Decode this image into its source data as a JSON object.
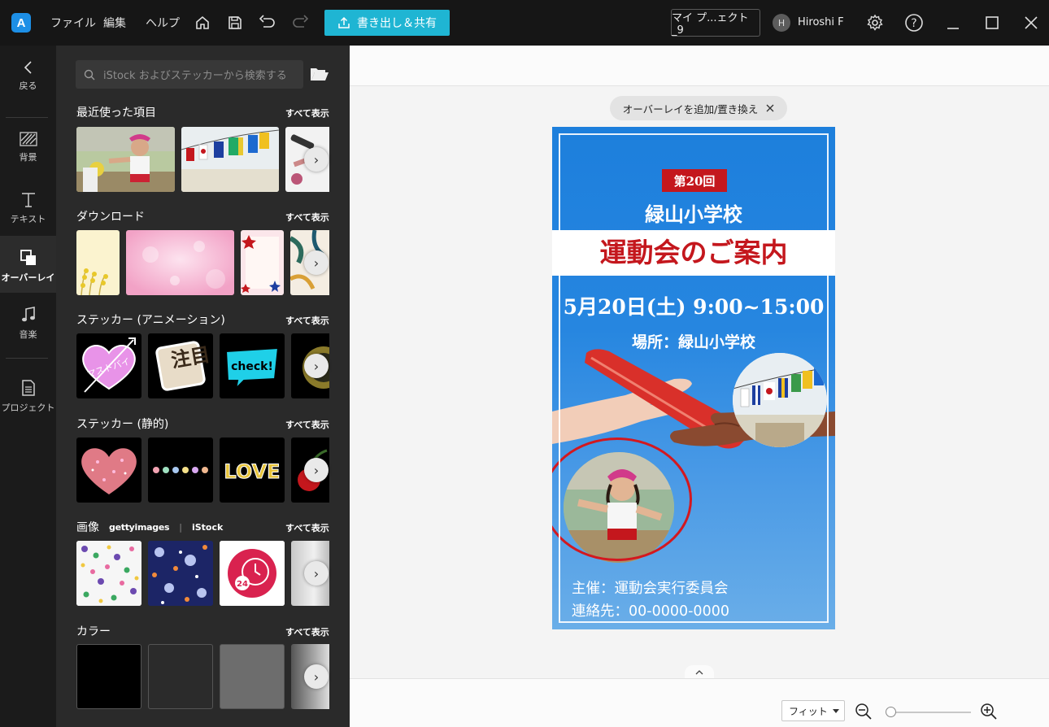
{
  "titlebar": {
    "logo": "A",
    "menus": [
      "ファイル",
      "編集",
      "ヘルプ"
    ],
    "export_label": "書き出し＆共有",
    "project_name": "マイ プ...ェクト_9",
    "user_initial": "H",
    "user_name": "Hiroshi F"
  },
  "leftnav": {
    "back": "戻る",
    "items": [
      "背景",
      "テキスト",
      "オーバーレイ",
      "音楽",
      "プロジェクト"
    ]
  },
  "panel": {
    "search_placeholder": "iStock およびステッカーから検索する",
    "see_all": "すべて表示",
    "sections": [
      {
        "title": "最近使った項目"
      },
      {
        "title": "ダウンロード"
      },
      {
        "title": "ステッカー (アニメーション)"
      },
      {
        "title": "ステッカー (静的)"
      },
      {
        "title": "画像",
        "providers": [
          "gettyimages",
          "iStock"
        ]
      },
      {
        "title": "カラー"
      }
    ],
    "sticker_texts": {
      "arrow_heart": "マストバイ",
      "attention": "注目",
      "check": "check!",
      "love": "LOVE",
      "clock": "24"
    }
  },
  "canvas": {
    "overlay_pill": "オーバーレイを追加/置き換え",
    "poster": {
      "badge": "第20回",
      "school": "緑山小学校",
      "event": "運動会のご案内",
      "datetime": "5月20日(土) 9:00~15:00",
      "place": "場所：緑山小学校",
      "organizer": "主催：運動会実行委員会",
      "contact": "連絡先：00-0000-0000"
    },
    "zoom": {
      "mode": "フィット"
    }
  },
  "colors": {
    "accent": "#1fb5d3",
    "poster_red": "#c4171d",
    "poster_blue": "#1d7fdc"
  }
}
